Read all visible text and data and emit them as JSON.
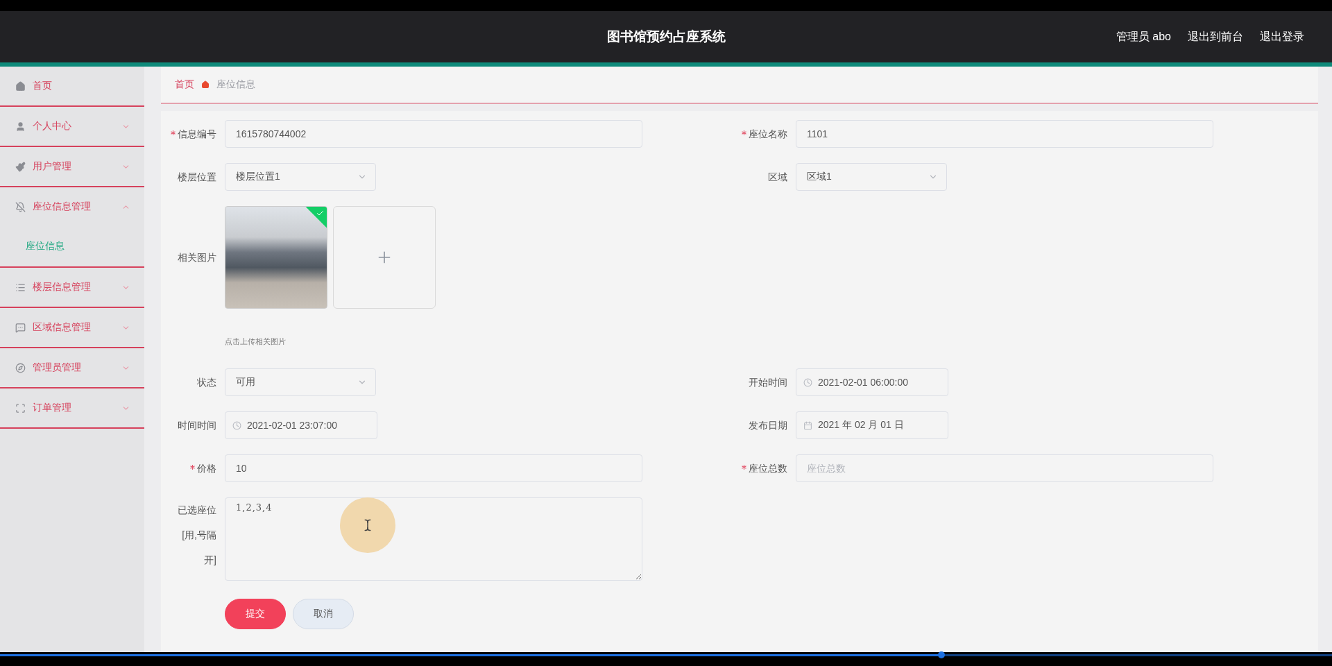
{
  "header": {
    "title": "图书馆预约占座系统",
    "user": "管理员 abo",
    "links": [
      "退出到前台",
      "退出登录"
    ]
  },
  "sidebar": {
    "items": [
      {
        "label": "首页"
      },
      {
        "label": "个人中心",
        "expanded": false
      },
      {
        "label": "用户管理",
        "expanded": false
      },
      {
        "label": "座位信息管理",
        "expanded": true,
        "children": [
          {
            "label": "座位信息",
            "selected": true
          }
        ]
      },
      {
        "label": "楼层信息管理",
        "expanded": false
      },
      {
        "label": "区域信息管理",
        "expanded": false
      },
      {
        "label": "管理员管理",
        "expanded": false
      },
      {
        "label": "订单管理",
        "expanded": false
      }
    ]
  },
  "breadcrumb": [
    {
      "label": "首页",
      "current": false
    },
    {
      "label": "座位信息",
      "current": true
    }
  ],
  "form": {
    "rows": [
      {
        "left": {
          "kind": "text",
          "label": "信息编号",
          "required": true,
          "value": "1615780744002"
        },
        "right": {
          "kind": "text",
          "label": "座位名称",
          "required": true,
          "value": "1101"
        }
      },
      {
        "left": {
          "kind": "select",
          "label": "楼层位置",
          "required": false,
          "value": "楼层位置1"
        },
        "right": {
          "kind": "select",
          "label": "区域",
          "required": false,
          "value": "区域1"
        }
      },
      {
        "left": {
          "kind": "image",
          "label": "相关图片",
          "required": false,
          "uploaded": true,
          "hint": "点击上传相关图片"
        }
      },
      {
        "left": {
          "kind": "select",
          "label": "状态",
          "required": false,
          "value": "可用"
        },
        "right": {
          "kind": "datetime",
          "label": "开始时间",
          "required": false,
          "value": "2021-02-01 06:00:00"
        }
      },
      {
        "left": {
          "kind": "datetime",
          "label": "时间时间",
          "required": false,
          "value": "2021-02-01 23:07:00"
        },
        "right": {
          "kind": "date",
          "label": "发布日期",
          "required": false,
          "value": "2021 年 02 月 01 日"
        }
      },
      {
        "left": {
          "kind": "text",
          "label": "价格",
          "required": true,
          "value": "10"
        },
        "right": {
          "kind": "text",
          "label": "座位总数",
          "required": true,
          "placeholder": "座位总数"
        }
      },
      {
        "left": {
          "kind": "textarea",
          "label": "已选座位[用,号隔开]",
          "required": false,
          "value": "1,2,3,4"
        }
      }
    ],
    "buttons": [
      {
        "label": "提交",
        "kind": "primary"
      },
      {
        "label": "取消",
        "kind": "secondary"
      }
    ]
  },
  "player": {
    "level": 0.707
  }
}
